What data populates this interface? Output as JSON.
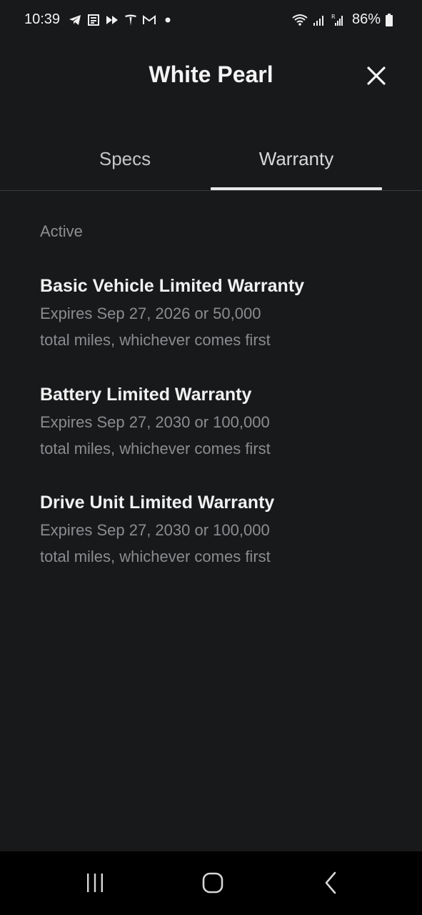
{
  "status_bar": {
    "time": "10:39",
    "battery_percent": "86%",
    "left_icons": [
      "telegram-icon",
      "news-icon",
      "forward-icon",
      "tesla-icon",
      "gmail-icon",
      "dot-icon"
    ],
    "right_icons": [
      "wifi-icon",
      "signal-icon",
      "signal-roaming-icon",
      "battery-icon"
    ]
  },
  "header": {
    "title": "White Pearl",
    "close_icon": "close-icon"
  },
  "tabs": [
    {
      "label": "Specs",
      "selected": false
    },
    {
      "label": "Warranty",
      "selected": true
    }
  ],
  "section": {
    "label": "Active"
  },
  "warranties": [
    {
      "title": "Basic Vehicle Limited Warranty",
      "line1": "Expires Sep 27, 2026 or 50,000",
      "line2": "total miles, whichever comes first"
    },
    {
      "title": "Battery Limited Warranty",
      "line1": "Expires Sep 27, 2030 or 100,000",
      "line2": "total miles, whichever comes first"
    },
    {
      "title": "Drive Unit Limited Warranty",
      "line1": "Expires Sep 27, 2030 or 100,000",
      "line2": "total miles, whichever comes first"
    }
  ],
  "nav_bar": {
    "icons": [
      "recents-icon",
      "home-icon",
      "back-icon"
    ]
  },
  "colors": {
    "background": "#18191b",
    "text_primary": "#f1f1f1",
    "text_secondary": "#8b8c8f",
    "tab_indicator": "#e7e7e7",
    "nav_background": "#000000"
  }
}
